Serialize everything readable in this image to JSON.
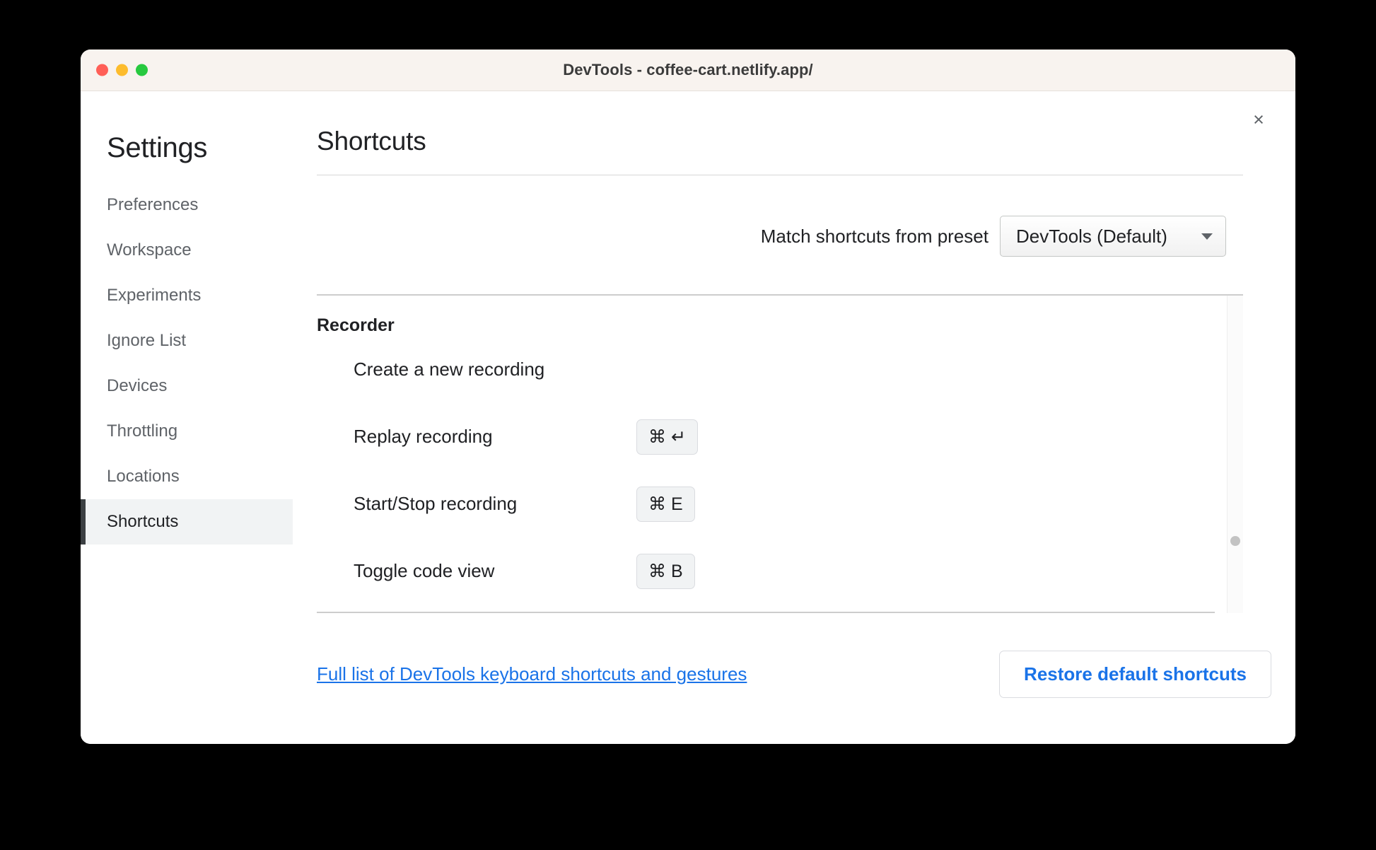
{
  "window": {
    "title": "DevTools - coffee-cart.netlify.app/",
    "traffic_lights": [
      "close",
      "minimize",
      "maximize"
    ]
  },
  "sidebar": {
    "heading": "Settings",
    "items": [
      {
        "label": "Preferences",
        "selected": false
      },
      {
        "label": "Workspace",
        "selected": false
      },
      {
        "label": "Experiments",
        "selected": false
      },
      {
        "label": "Ignore List",
        "selected": false
      },
      {
        "label": "Devices",
        "selected": false
      },
      {
        "label": "Throttling",
        "selected": false
      },
      {
        "label": "Locations",
        "selected": false
      },
      {
        "label": "Shortcuts",
        "selected": true
      }
    ]
  },
  "main": {
    "page_title": "Shortcuts",
    "close_icon": "×",
    "preset": {
      "label": "Match shortcuts from preset",
      "selected_value": "DevTools (Default)",
      "caret_icon": "chevron-down-icon"
    },
    "sections": [
      {
        "title": "Recorder",
        "rows": [
          {
            "name": "Create a new recording",
            "keys": []
          },
          {
            "name": "Replay recording",
            "keys": [
              "⌘ ↵"
            ]
          },
          {
            "name": "Start/Stop recording",
            "keys": [
              "⌘ E"
            ]
          },
          {
            "name": "Toggle code view",
            "keys": [
              "⌘ B"
            ]
          }
        ]
      }
    ]
  },
  "footer": {
    "link_text": "Full list of DevTools keyboard shortcuts and gestures",
    "restore_button": "Restore default shortcuts"
  },
  "colors": {
    "accent_blue": "#1a73e8",
    "titlebar_bg": "#f8f3ef",
    "selected_nav_bg": "#f1f3f4",
    "selected_nav_bar": "#3c4043",
    "chip_bg": "#f1f3f4",
    "divider": "#cdcdcd"
  }
}
